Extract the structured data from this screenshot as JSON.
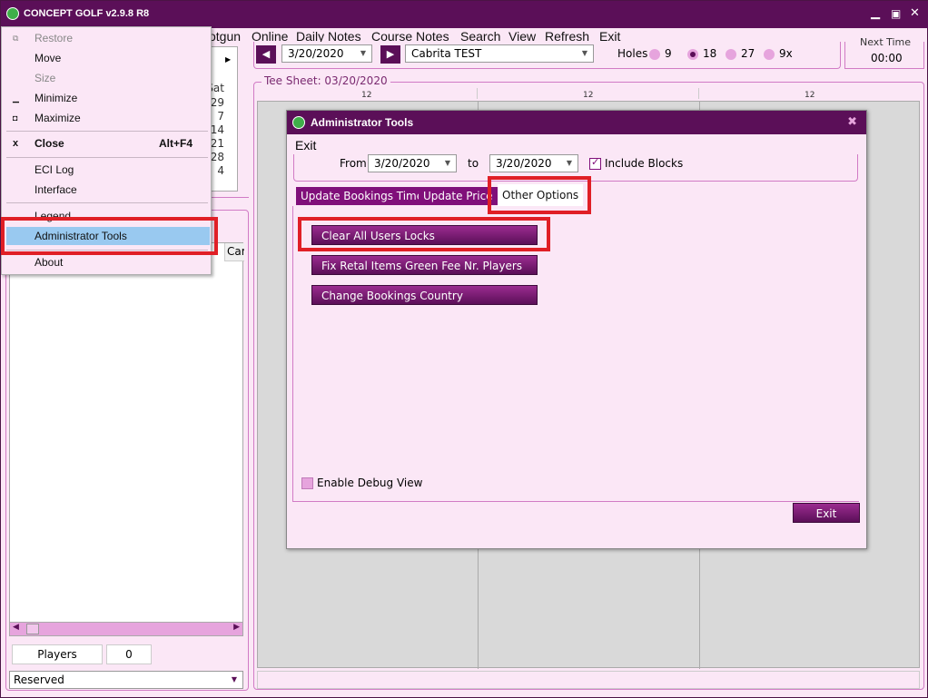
{
  "window": {
    "title": "CONCEPT GOLF v2.9.8 R8"
  },
  "menu": [
    "otgun",
    "Online",
    "Daily Notes",
    "Course Notes",
    "Search",
    "View",
    "Refresh",
    "Exit"
  ],
  "toolbar": {
    "date": "3/20/2020",
    "course": "Cabrita TEST",
    "holes_label": "Holes",
    "holes": [
      "9",
      "18",
      "27",
      "9x"
    ],
    "holes_selected": "18",
    "next_time_label": "Next Time",
    "next_time": "00:00"
  },
  "calendar": {
    "header": "Sat",
    "days": [
      "29",
      "7",
      "14",
      "21",
      "28",
      "4"
    ]
  },
  "list": {
    "col": "Car"
  },
  "bottom": {
    "players_label": "Players",
    "players_count": "0",
    "status": "Reserved"
  },
  "teesheet": {
    "label": "Tee Sheet: 03/20/2020",
    "columns": [
      "12",
      "12",
      "12"
    ]
  },
  "context_menu": {
    "items": [
      {
        "label": "Restore",
        "disabled": true,
        "glyph": "⧉"
      },
      {
        "label": "Move"
      },
      {
        "label": "Size",
        "disabled": true
      },
      {
        "label": "Minimize",
        "glyph": "▁"
      },
      {
        "label": "Maximize",
        "glyph": "◘"
      },
      {
        "label": "Close",
        "glyph": "x",
        "shortcut": "Alt+F4"
      },
      {
        "label": "ECI Log"
      },
      {
        "label": "Interface"
      },
      {
        "label": "Legend"
      },
      {
        "label": "Administrator Tools"
      },
      {
        "label": "About"
      }
    ]
  },
  "dialog": {
    "title": "Administrator Tools",
    "menu_exit": "Exit",
    "from_label": "From",
    "from_date": "3/20/2020",
    "to_label": "to",
    "to_date": "3/20/2020",
    "include_blocks": "Include Blocks",
    "tabs": [
      "Update Bookings Time",
      "Update Price",
      "Other Options"
    ],
    "buttons": [
      "Clear All Users Locks",
      "Fix Retal Items Green Fee Nr. Players",
      "Change Bookings Country"
    ],
    "debug": "Enable Debug View",
    "exit_button": "Exit"
  }
}
